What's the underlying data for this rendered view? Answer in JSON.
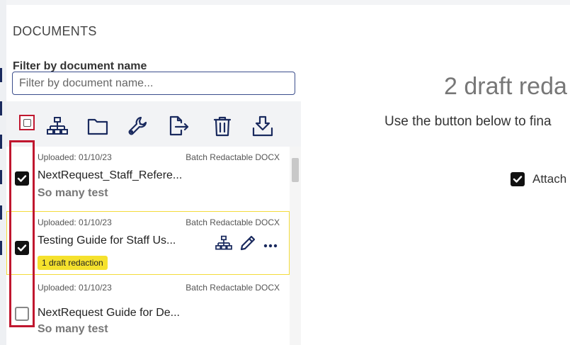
{
  "documents": {
    "title": "DOCUMENTS",
    "filter_label": "Filter by document name",
    "filter_placeholder": "Filter by document name...",
    "toolbar": {
      "icons": [
        "hierarchy-icon",
        "folder-icon",
        "wrench-icon",
        "export-icon",
        "trash-icon",
        "download-tray-icon"
      ]
    },
    "items": [
      {
        "uploaded": "Uploaded: 01/10/23",
        "type": "Batch Redactable DOCX",
        "name": "NextRequest_Staff_Refere...",
        "subtitle": "So many test",
        "checked": true,
        "selected": false
      },
      {
        "uploaded": "Uploaded: 01/10/23",
        "type": "Batch Redactable DOCX",
        "name": "Testing Guide for Staff Us...",
        "badge": "1 draft redaction",
        "checked": true,
        "selected": true
      },
      {
        "uploaded": "Uploaded: 01/10/23",
        "type": "Batch Redactable DOCX",
        "name": "NextRequest Guide for De...",
        "subtitle": "So many test",
        "checked": false,
        "selected": false
      }
    ]
  },
  "right_panel": {
    "heading": "2 draft reda",
    "subtext": "Use the button below to fina",
    "attach_label": "Attach",
    "attach_checked": true
  },
  "colors": {
    "accent": "#1a2a5e",
    "highlight_red": "#c0172f",
    "badge_yellow": "#f5e12d",
    "selected_border": "#f4dc3c"
  }
}
